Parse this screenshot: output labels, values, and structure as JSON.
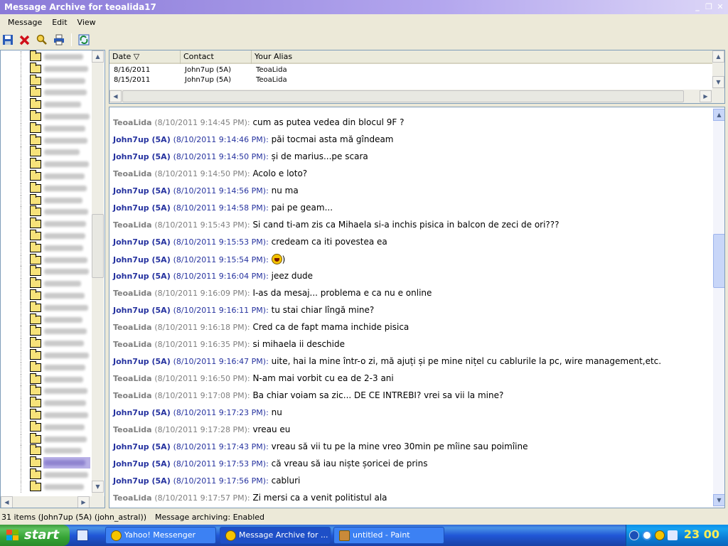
{
  "window": {
    "title": "Message Archive for teoalida17"
  },
  "menu": [
    "Message",
    "Edit",
    "View"
  ],
  "toolbar": {
    "icons": [
      "save-icon",
      "delete-icon",
      "find-icon",
      "print-icon",
      "refresh-icon"
    ],
    "colors": {
      "save": "#2a5bb8",
      "delete": "#d0101a",
      "find": "#d4a000",
      "print": "#2a5bb8",
      "refresh": "#1a8a3a"
    }
  },
  "list": {
    "columns": [
      "Date ▽",
      "Contact",
      "Your Alias"
    ],
    "rows": [
      {
        "date": "8/16/2011",
        "contact": "John7up (5A)",
        "alias": "TeoaLida"
      },
      {
        "date": "8/15/2011",
        "contact": "John7up (5A)",
        "alias": "TeoaLida"
      }
    ]
  },
  "chat": {
    "messages": [
      {
        "who": "teo",
        "name": "TeoaLida",
        "ts": "(8/10/2011 9:14:45 PM):",
        "text": "cum as putea vedea din blocul 9F ?"
      },
      {
        "who": "john",
        "name": "John7up (5A)",
        "ts": "(8/10/2011 9:14:46 PM):",
        "text": "păi tocmai asta mă gîndeam"
      },
      {
        "who": "john",
        "name": "John7up (5A)",
        "ts": "(8/10/2011 9:14:50 PM):",
        "text": "și de marius...pe scara"
      },
      {
        "who": "teo",
        "name": "TeoaLida",
        "ts": "(8/10/2011 9:14:50 PM):",
        "text": "Acolo e loto?"
      },
      {
        "who": "john",
        "name": "John7up (5A)",
        "ts": "(8/10/2011 9:14:56 PM):",
        "text": "nu ma"
      },
      {
        "who": "john",
        "name": "John7up (5A)",
        "ts": "(8/10/2011 9:14:58 PM):",
        "text": "pai pe geam..."
      },
      {
        "who": "teo",
        "name": "TeoaLida",
        "ts": "(8/10/2011 9:15:43 PM):",
        "text": "Si cand ti-am zis ca Mihaela si-a inchis pisica in balcon de zeci de ori???"
      },
      {
        "who": "john",
        "name": "John7up (5A)",
        "ts": "(8/10/2011 9:15:53 PM):",
        "text": "credeam ca iti povestea ea"
      },
      {
        "who": "john",
        "name": "John7up (5A)",
        "ts": "(8/10/2011 9:15:54 PM):",
        "text": ")",
        "emoji": true
      },
      {
        "who": "john",
        "name": "John7up (5A)",
        "ts": "(8/10/2011 9:16:04 PM):",
        "text": "jeez dude"
      },
      {
        "who": "teo",
        "name": "TeoaLida",
        "ts": "(8/10/2011 9:16:09 PM):",
        "text": "I-as da mesaj... problema e ca nu e online"
      },
      {
        "who": "john",
        "name": "John7up (5A)",
        "ts": "(8/10/2011 9:16:11 PM):",
        "text": "tu stai chiar lîngă mine?"
      },
      {
        "who": "teo",
        "name": "TeoaLida",
        "ts": "(8/10/2011 9:16:18 PM):",
        "text": "Cred ca de fapt mama inchide pisica"
      },
      {
        "who": "teo",
        "name": "TeoaLida",
        "ts": "(8/10/2011 9:16:35 PM):",
        "text": "si mihaela ii deschide"
      },
      {
        "who": "john",
        "name": "John7up (5A)",
        "ts": "(8/10/2011 9:16:47 PM):",
        "text": "uite, hai la mine într-o zi, mă ajuți și pe mine nițel cu cablurile la pc, wire management,etc."
      },
      {
        "who": "teo",
        "name": "TeoaLida",
        "ts": "(8/10/2011 9:16:50 PM):",
        "text": "N-am mai vorbit cu ea de 2-3 ani"
      },
      {
        "who": "teo",
        "name": "TeoaLida",
        "ts": "(8/10/2011 9:17:08 PM):",
        "text": "Ba chiar voiam sa zic... DE CE INTREBI? vrei sa vii la mine?"
      },
      {
        "who": "john",
        "name": "John7up (5A)",
        "ts": "(8/10/2011 9:17:23 PM):",
        "text": "nu"
      },
      {
        "who": "teo",
        "name": "TeoaLida",
        "ts": "(8/10/2011 9:17:28 PM):",
        "text": "vreau eu"
      },
      {
        "who": "john",
        "name": "John7up (5A)",
        "ts": "(8/10/2011 9:17:43 PM):",
        "text": "vreau să vii tu pe la mine vreo 30min pe mîine sau poimîine"
      },
      {
        "who": "john",
        "name": "John7up (5A)",
        "ts": "(8/10/2011 9:17:53 PM):",
        "text": "că vreau să iau niște șoricei de prins"
      },
      {
        "who": "john",
        "name": "John7up (5A)",
        "ts": "(8/10/2011 9:17:56 PM):",
        "text": "cabluri"
      },
      {
        "who": "teo",
        "name": "TeoaLida",
        "ts": "(8/10/2011 9:17:57 PM):",
        "text": "Zi mersi ca a venit politistul ala"
      }
    ]
  },
  "status": {
    "items": "31 items (John7up (5A) (john_astral))",
    "archiving": "Message archiving: Enabled"
  },
  "taskbar": {
    "start": "start",
    "tasks": [
      "Yahoo! Messenger",
      "Message Archive for ...",
      "untitled - Paint"
    ],
    "clock": "23 00"
  }
}
